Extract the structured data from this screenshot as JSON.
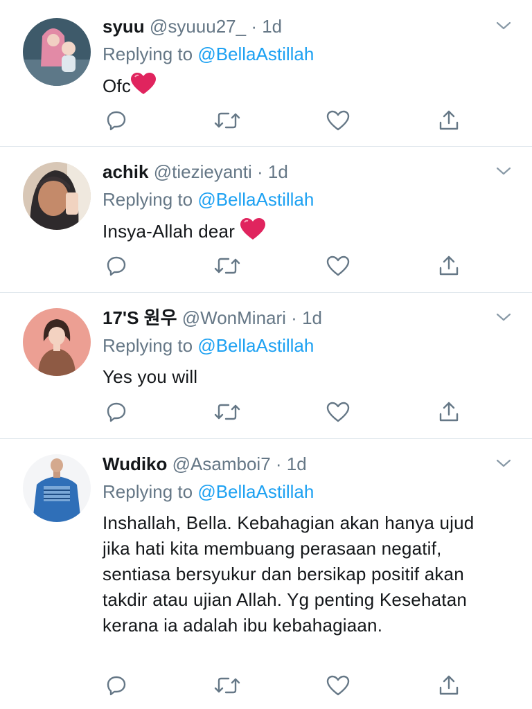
{
  "tweets": [
    {
      "name": "syuu",
      "handle": "@syuuu27_",
      "dot": "·",
      "time": "1d",
      "replying_prefix": "Replying to",
      "mention": "@BellaAstillah",
      "text": "Ofc",
      "emoji": "heart-emoji"
    },
    {
      "name": "achik",
      "handle": "@tiezieyanti",
      "dot": "·",
      "time": "1d",
      "replying_prefix": "Replying to",
      "mention": "@BellaAstillah",
      "text": "Insya-Allah dear ",
      "emoji": "heart-emoji"
    },
    {
      "name": "17'S 원우",
      "handle": "@WonMinari",
      "dot": "·",
      "time": "1d",
      "replying_prefix": "Replying to",
      "mention": "@BellaAstillah",
      "text": "Yes you will"
    },
    {
      "name": "Wudiko",
      "handle": "@Asamboi7",
      "dot": "·",
      "time": "1d",
      "replying_prefix": "Replying to",
      "mention": "@BellaAstillah",
      "text": "Inshallah, Bella. Kebahagian akan hanya ujud jika hati kita membuang perasaan negatif, sentiasa bersyukur dan bersikap positif akan takdir atau ujian Allah. Yg penting Kesehatan kerana ia adalah ibu kebahagiaan."
    }
  ],
  "icons": {
    "reply": "reply-icon",
    "retweet": "retweet-icon",
    "like": "like-icon",
    "share": "share-icon",
    "more": "chevron-down-icon"
  },
  "colors": {
    "mention": "#1da1f2",
    "secondary_text": "#657786",
    "primary_text": "#14171a",
    "divider": "#e1e8ed",
    "heart": "#e0245e"
  }
}
